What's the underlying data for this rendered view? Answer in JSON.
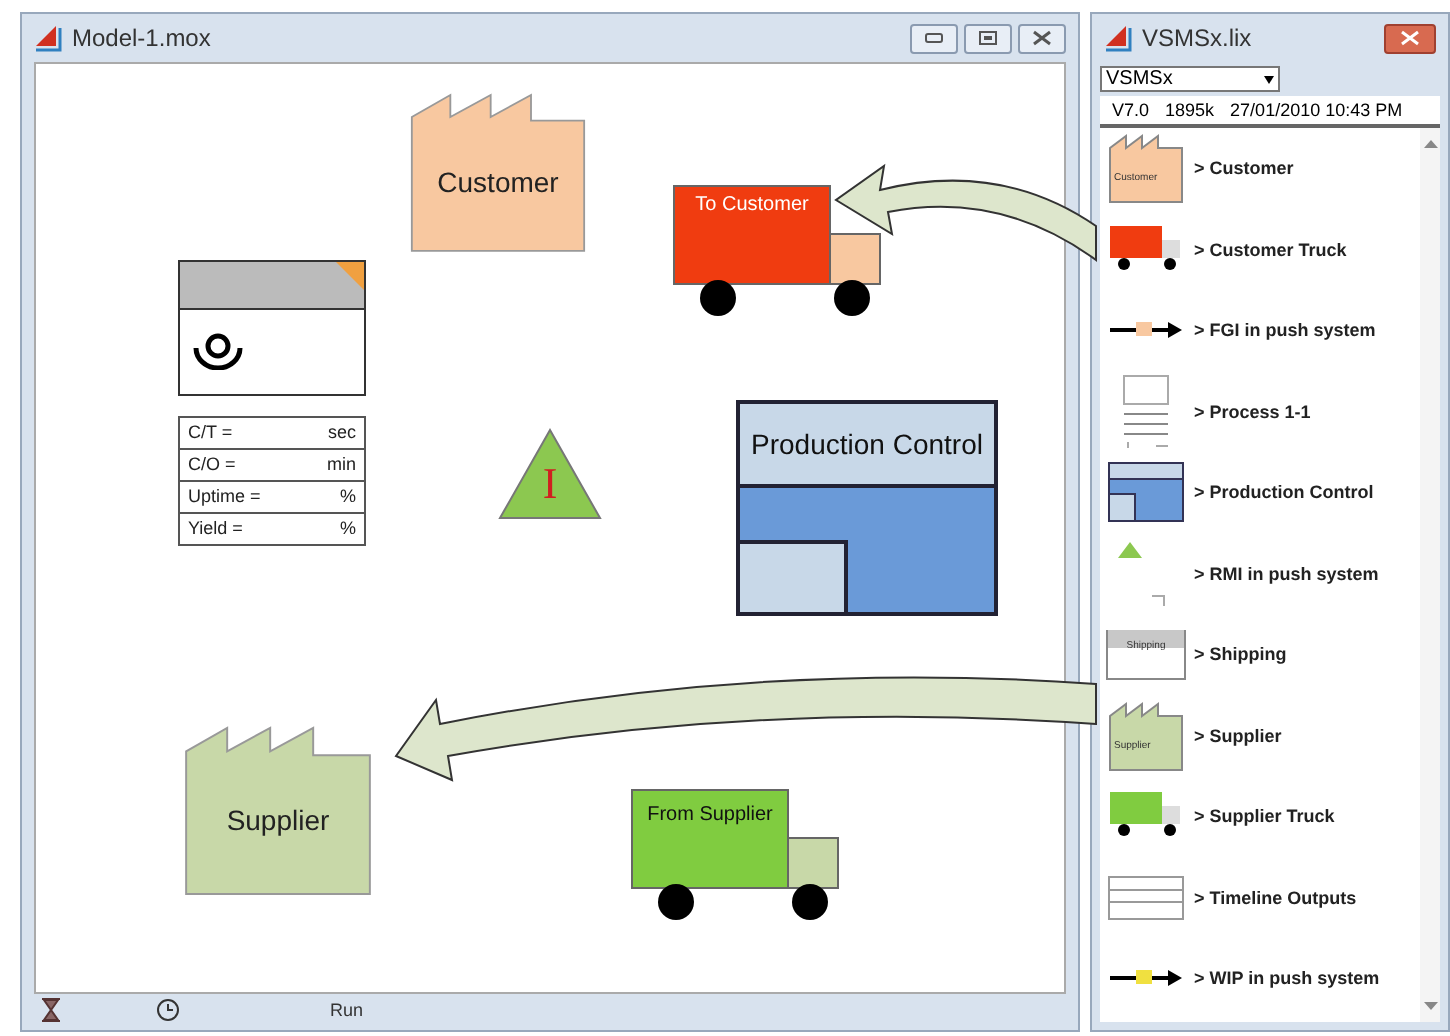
{
  "model_window": {
    "title": "Model-1.mox"
  },
  "canvas": {
    "shapes": [
      {
        "kind": "factory",
        "label": "Customer",
        "color": "#f8c8a0"
      },
      {
        "kind": "truck",
        "label": "To Customer",
        "color": "#f03c10"
      },
      {
        "kind": "process",
        "rows": [
          {
            "label": "C/T =",
            "unit": "sec"
          },
          {
            "label": "C/O =",
            "unit": "min"
          },
          {
            "label": "Uptime =",
            "unit": "%"
          },
          {
            "label": "Yield =",
            "unit": "%"
          }
        ]
      },
      {
        "kind": "inventory",
        "label": "I"
      },
      {
        "kind": "production_control",
        "label": "Production Control"
      },
      {
        "kind": "factory",
        "label": "Supplier",
        "color": "#c8d8a8"
      },
      {
        "kind": "truck",
        "label": "From Supplier",
        "color": "#80cc40"
      }
    ]
  },
  "status_bar": {
    "run_label": "Run"
  },
  "library": {
    "title": "VSMSx.lix",
    "dropdown": "VSMSx",
    "version": "V7.0",
    "size": "1895k",
    "date": "27/01/2010 10:43 PM",
    "items": [
      {
        "kind": "factory",
        "thumb_label": "Customer",
        "color": "#f8c8a0",
        "label": "> Customer"
      },
      {
        "kind": "truck",
        "color": "#f03c10",
        "label": "> Customer Truck"
      },
      {
        "kind": "push",
        "label": "> FGI in push system"
      },
      {
        "kind": "process",
        "label": "> Process 1-1"
      },
      {
        "kind": "control",
        "label": "> Production Control"
      },
      {
        "kind": "rmi",
        "label": "> RMI in push system"
      },
      {
        "kind": "shipping",
        "thumb_label": "Shipping",
        "label": "> Shipping"
      },
      {
        "kind": "factory",
        "thumb_label": "Supplier",
        "color": "#c8d8a8",
        "label": "> Supplier"
      },
      {
        "kind": "truck",
        "color": "#80cc40",
        "label": "> Supplier Truck"
      },
      {
        "kind": "timeline",
        "label": "> Timeline Outputs"
      },
      {
        "kind": "push",
        "label": "> WIP in push system"
      }
    ]
  }
}
